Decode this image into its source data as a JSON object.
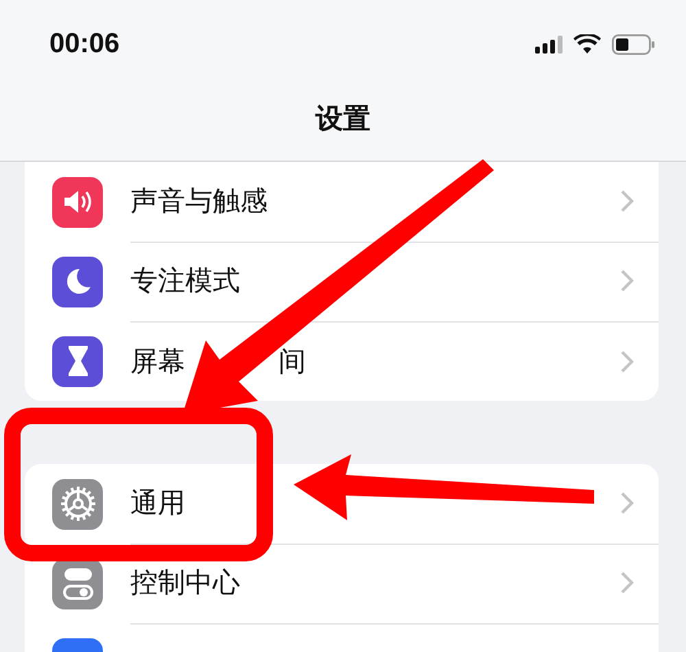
{
  "status_bar": {
    "time": "00:06"
  },
  "nav": {
    "title": "设置"
  },
  "groups": [
    {
      "items": [
        {
          "color": "#f0375a",
          "label": "声音与触感"
        },
        {
          "color": "#5c4ed6",
          "label": "专注模式"
        },
        {
          "color": "#5c4ed6",
          "label": "屏幕",
          "label_after": "间"
        }
      ]
    },
    {
      "items": [
        {
          "color": "#8e8e93",
          "label": "通用"
        },
        {
          "color": "#8e8e93",
          "label": "控制中心"
        },
        {
          "color": "#2f6ff5"
        }
      ]
    }
  ]
}
